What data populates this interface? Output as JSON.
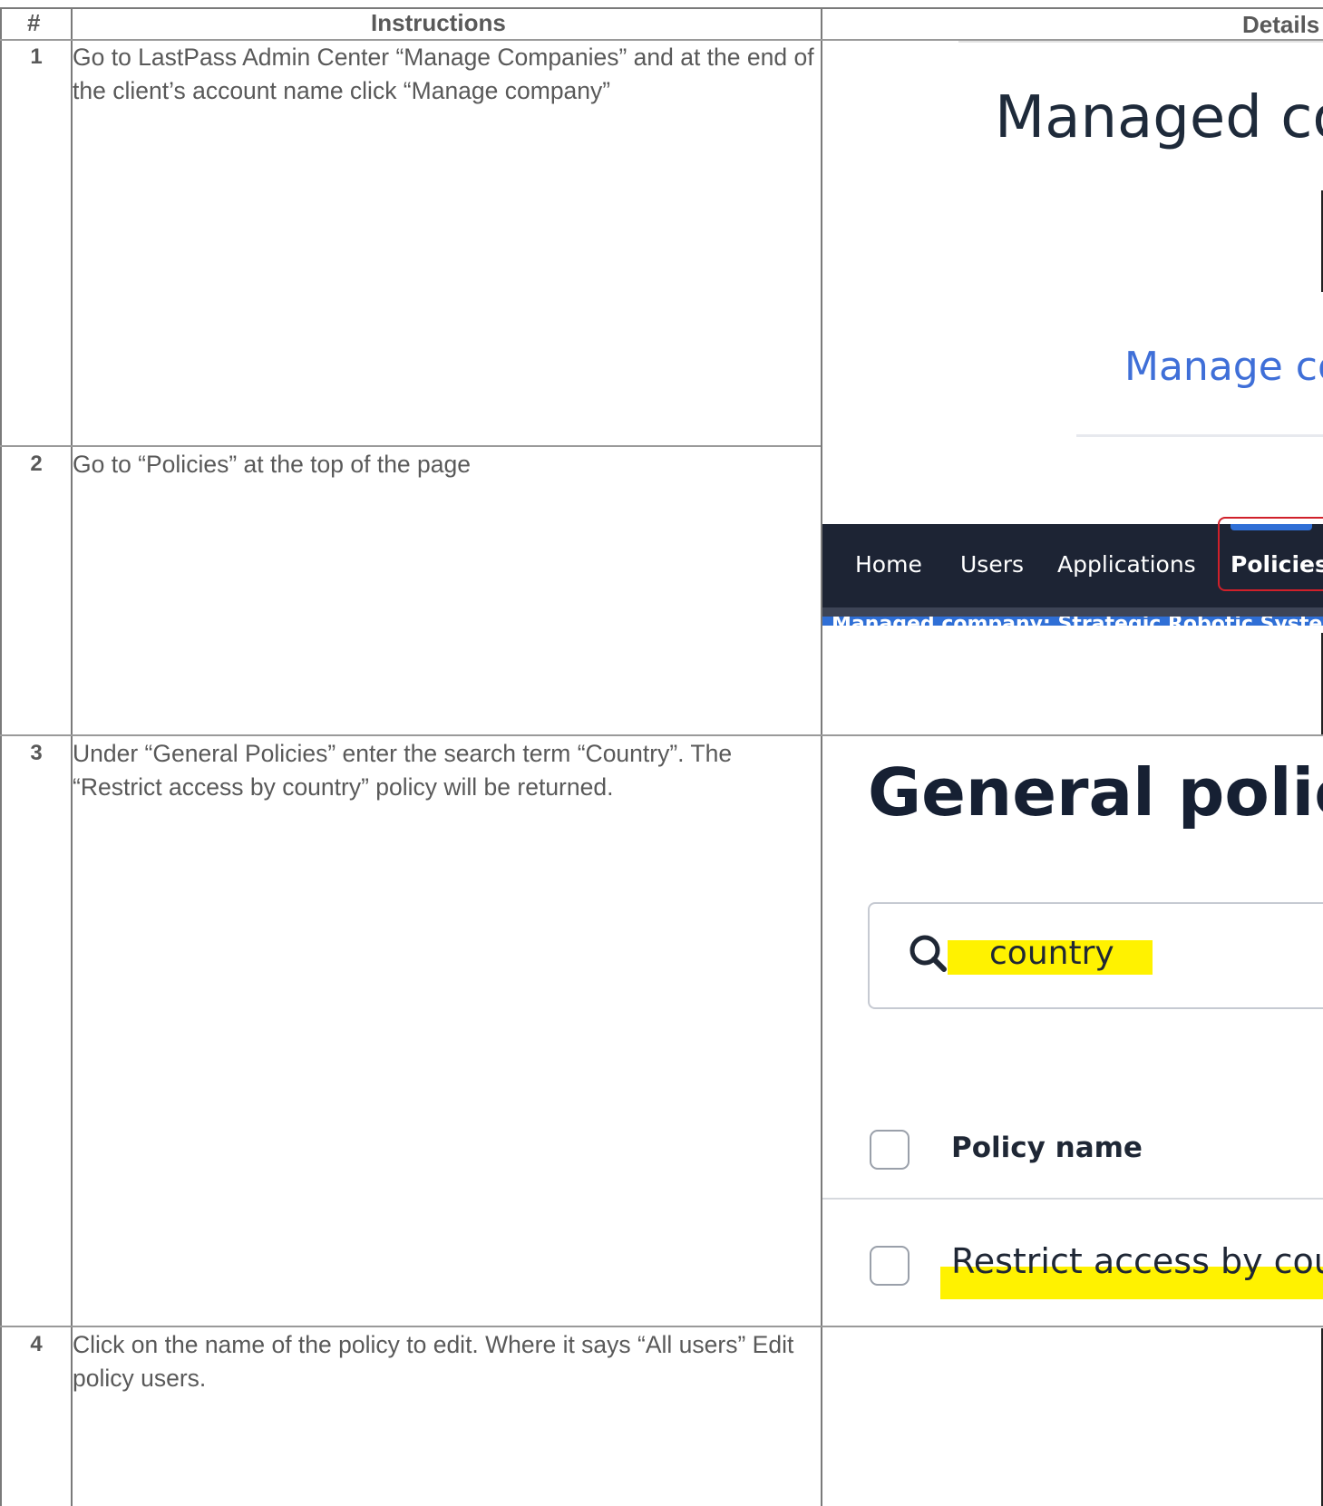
{
  "table": {
    "headers": {
      "num": "#",
      "instructions": "Instructions",
      "details": "Details"
    },
    "rows": [
      {
        "num": "1",
        "instruction": "Go to LastPass Admin Center “Manage Companies” and at the end of the client’s account name click “Manage company”"
      },
      {
        "num": "2",
        "instruction": "Go to “Policies” at the top of the page"
      },
      {
        "num": "3",
        "instruction": "Under “General Policies” enter the search term “Country”. The “Restrict access by country” policy will be returned."
      },
      {
        "num": "4",
        "instruction": "Click on the name of the policy to edit. Where it says “All users” Edit policy users."
      }
    ]
  },
  "shot1": {
    "title": "Managed co",
    "link": "Manage co"
  },
  "shot2": {
    "nav": [
      "Home",
      "Users",
      "Applications",
      "Policies"
    ],
    "banner": "Managed company: Strategic Robotic Systems"
  },
  "shot3": {
    "title": "General polici",
    "search_value": "country",
    "column_header": "Policy name",
    "row_label": "Restrict access by coun"
  },
  "colors": {
    "highlight": "#fff200",
    "nav_bg": "#1d2434",
    "link_blue": "#3f6fd8",
    "annotation_red": "#d0202a"
  }
}
